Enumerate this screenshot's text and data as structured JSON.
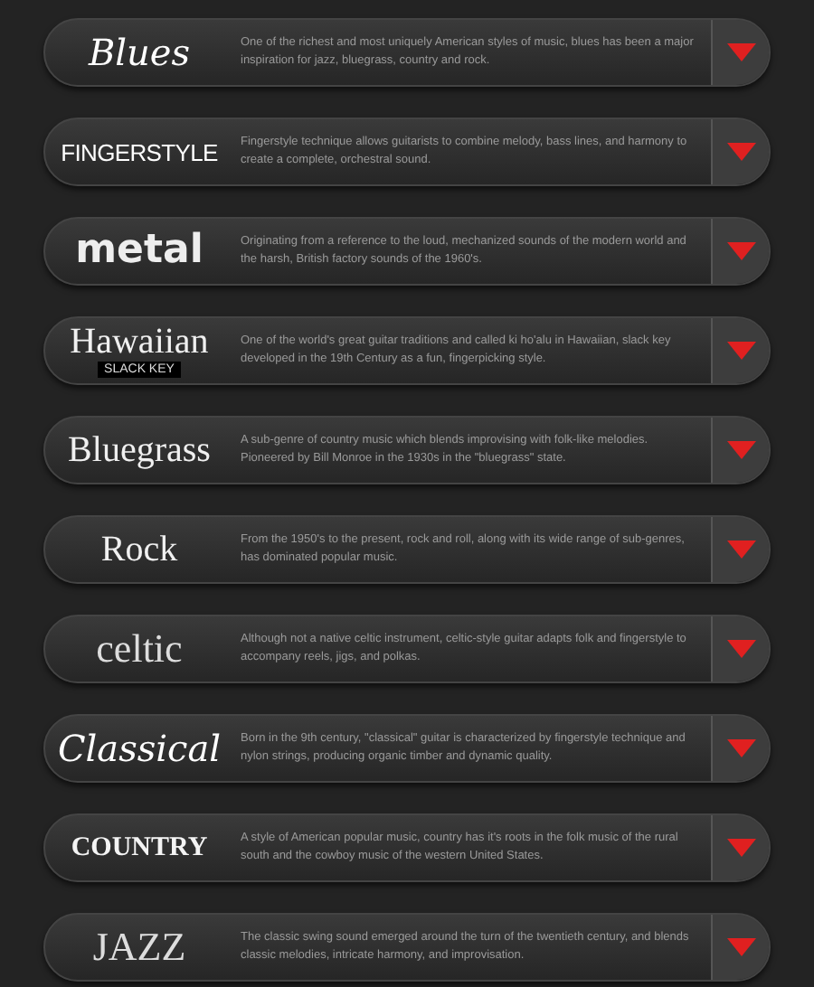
{
  "genres": [
    {
      "logo": {
        "kind": "script",
        "text": "Blues"
      },
      "description": "One of the richest and most uniquely American styles of music, blues has been a major inspiration for jazz, bluegrass, country and rock."
    },
    {
      "logo": {
        "kind": "caps",
        "text": "FINGERSTYLE"
      },
      "description": "Fingerstyle technique allows guitarists to combine melody, bass lines, and harmony to create a complete, orchestral sound."
    },
    {
      "logo": {
        "kind": "heavy",
        "text": "metal"
      },
      "description": "Originating from a reference to the loud, mechanized sounds of the modern world and the harsh, British factory sounds of the 1960's."
    },
    {
      "logo": {
        "kind": "serif",
        "text": "Hawaiian",
        "subtitle": "SLACK KEY"
      },
      "description": "One of the world's great guitar traditions and called ki ho'alu in Hawaiian, slack key developed in the 19th Century as a fun, fingerpicking style."
    },
    {
      "logo": {
        "kind": "serif",
        "text": "Bluegrass"
      },
      "description": "A sub-genre of country music which blends improvising with folk-like melodies. Pioneered by Bill Monroe in the 1930s in the \"bluegrass\" state."
    },
    {
      "logo": {
        "kind": "serif",
        "text": "Rock"
      },
      "description": "From the 1950's to the present, rock and roll, along with its wide range of sub-genres, has dominated popular music."
    },
    {
      "logo": {
        "kind": "light",
        "text": "celtic"
      },
      "description": "Although not a native celtic instrument, celtic-style guitar adapts folk and fingerstyle to accompany reels, jigs, and polkas."
    },
    {
      "logo": {
        "kind": "script",
        "text": "Classical"
      },
      "description": "Born in the 9th century, \"classical\" guitar is characterized by fingerstyle technique and nylon strings, producing organic timber and dynamic quality."
    },
    {
      "logo": {
        "kind": "serifcaps",
        "text": "COUNTRY"
      },
      "description": "A style of American popular music, country has it's roots in the folk music of the rural south and the cowboy music of the western United States."
    },
    {
      "logo": {
        "kind": "light",
        "text": "JAZZ"
      },
      "description": "The classic swing sound emerged around the turn of the twentieth century, and blends classic melodies, intricate harmony, and improvisation."
    }
  ]
}
